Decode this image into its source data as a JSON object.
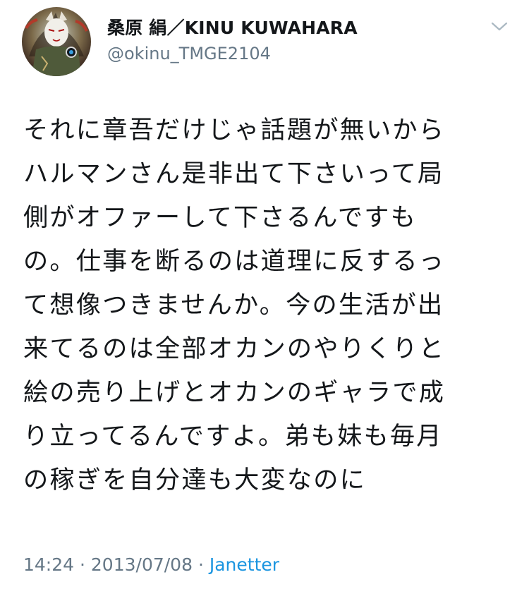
{
  "author": {
    "display_name": "桑原 絹／KINU KUWAHARA",
    "handle": "@okinu_TMGE2104"
  },
  "tweet": {
    "lines": [
      "それに章吾だけじゃ話題が無いから",
      "ハルマンさん是非出て下さいって局",
      "側がオファーして下さるんですも",
      "の。仕事を断るのは道理に反するっ",
      "て想像つきませんか。今の生活が出",
      "来てるのは全部オカンのやりくりと",
      "絵の売り上げとオカンのギャラで成",
      "り立ってるんですよ。弟も妹も毎月",
      "の稼ぎを自分達も大変なのに"
    ]
  },
  "meta": {
    "time": "14:24",
    "separator": "·",
    "date": "2013/07/08",
    "separator2": "·",
    "source": "Janetter"
  },
  "icons": {
    "menu": "chevron-down-icon",
    "avatar": "avatar-image"
  },
  "colors": {
    "text": "#14171a",
    "secondary": "#657786",
    "link": "#1b95e0"
  }
}
